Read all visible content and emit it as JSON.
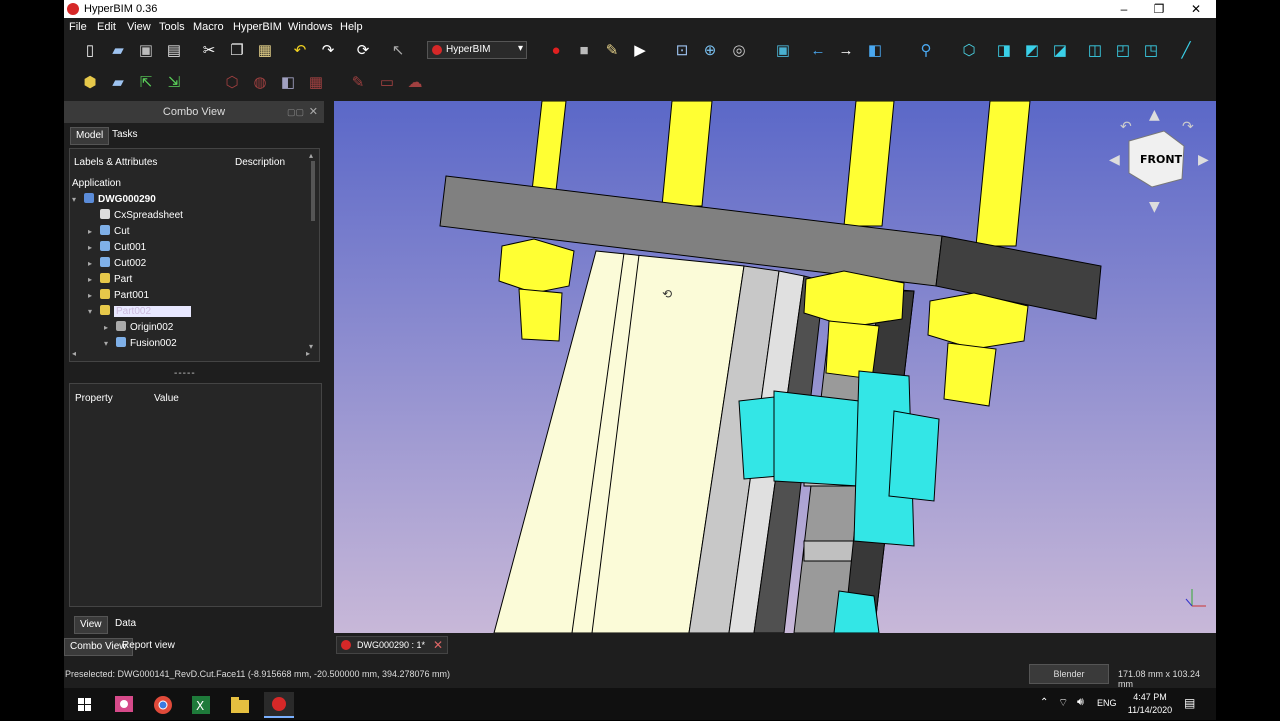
{
  "window": {
    "title": "HyperBIM 0.36",
    "controls": [
      "–",
      "❐",
      "✕"
    ]
  },
  "menu": [
    "File",
    "Edit",
    "View",
    "Tools",
    "Macro",
    "HyperBIM",
    "Windows",
    "Help"
  ],
  "toolbar": {
    "workbench": "HyperBIM",
    "icons1": [
      "new-file-icon",
      "open-file-icon",
      "save-icon",
      "print-icon",
      "cut-icon",
      "copy-icon",
      "paste-icon",
      "undo-icon",
      "redo-icon",
      "refresh-icon",
      "whats-this-icon"
    ],
    "icons2": [
      "record-macro-icon",
      "stop-macro-icon",
      "edit-macro-icon",
      "run-macro-icon",
      "fit-all-icon",
      "fit-selection-icon",
      "draw-style-icon",
      "bounding-box-icon",
      "back-icon",
      "forward-icon",
      "std-views-icon",
      "zoom-icon",
      "isometric-icon",
      "front-view-icon",
      "top-view-icon",
      "right-view-icon",
      "rear-view-icon",
      "bottom-view-icon",
      "left-view-icon",
      "measure-icon"
    ]
  },
  "combo": {
    "title": "Combo View",
    "tabs": [
      "Model",
      "Tasks"
    ],
    "tree_headers": [
      "Labels & Attributes",
      "Description"
    ],
    "tree_root": "Application",
    "tree": [
      {
        "label": "DWG000290",
        "level": 0,
        "arrow": "v",
        "icon": "#5b8cd9",
        "bold": true
      },
      {
        "label": "CxSpreadsheet",
        "level": 1,
        "arrow": "",
        "icon": "#dddddd"
      },
      {
        "label": "Cut",
        "level": 1,
        "arrow": ">",
        "icon": "#7fb0e8"
      },
      {
        "label": "Cut001",
        "level": 1,
        "arrow": ">",
        "icon": "#7fb0e8"
      },
      {
        "label": "Cut002",
        "level": 1,
        "arrow": ">",
        "icon": "#7fb0e8"
      },
      {
        "label": "Part",
        "level": 1,
        "arrow": ">",
        "icon": "#e6c84a"
      },
      {
        "label": "Part001",
        "level": 1,
        "arrow": ">",
        "icon": "#e6c84a"
      },
      {
        "label": "Part002",
        "level": 1,
        "arrow": "v",
        "icon": "#e6c84a",
        "selected": true
      },
      {
        "label": "Origin002",
        "level": 2,
        "arrow": ">",
        "icon": "#aaaaaa"
      },
      {
        "label": "Fusion002",
        "level": 2,
        "arrow": "v",
        "icon": "#7fb0e8"
      }
    ],
    "splitter": "-----",
    "prop_headers": [
      "Property",
      "Value"
    ],
    "bottom_tabs": [
      "View",
      "Data"
    ],
    "view_tabs": [
      "Combo View",
      "Report view"
    ]
  },
  "document_tab": "DWG000290 : 1*",
  "navcube_label": "FRONT",
  "status": {
    "message": "Preselected: DWG000141_RevD.Cut.Face11 (-8.915668 mm, -20.500000 mm, 394.278076 mm)",
    "nav_style": "Blender",
    "dimensions": "171.08 mm x 103.24 mm"
  },
  "taskbar": {
    "lang": "ENG",
    "time": "4:47 PM",
    "date": "11/14/2020"
  },
  "colors": {
    "accent": "#d62828",
    "bolt_yellow": "#ffff33",
    "part_cyan": "#33e6e6",
    "panel_cream": "#fbfbd8",
    "plate_gray": "#808080"
  }
}
